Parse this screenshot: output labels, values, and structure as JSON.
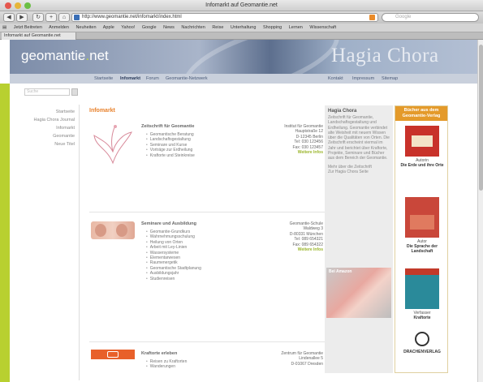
{
  "window": {
    "title": "Infomarkt auf Geomantie.net",
    "url": "http://www.geomantie.net/infomarkt/index.html",
    "search_placeholder": "Google"
  },
  "bookmarks": [
    "Jetzt Beitreten",
    "Anmelden",
    "Neuheiten",
    "Apple",
    "Yahoo!",
    "Google",
    "News",
    "Nachrichten",
    "Reise",
    "Unterhaltung",
    "Shopping",
    "Lernen",
    "Wissenschaft"
  ],
  "tab": {
    "label": "Infomarkt auf Geomantie.net"
  },
  "header": {
    "logo_main": "geomantie",
    "logo_dot": ".",
    "logo_tld": "net",
    "hagia": "Hagia Chora"
  },
  "nav": {
    "items": [
      {
        "label": "Startseite"
      },
      {
        "label": "Infomarkt"
      },
      {
        "label": "Forum"
      },
      {
        "label": "Geomantie-Netzwerk"
      }
    ],
    "right": [
      {
        "label": "Kontakt"
      },
      {
        "label": "Impressum"
      },
      {
        "label": "Sitemap"
      }
    ]
  },
  "left": {
    "search_placeholder": "Suche",
    "links": [
      {
        "label": "Startseite"
      },
      {
        "label": "Hagia Chora Journal"
      },
      {
        "label": "Infomarkt"
      },
      {
        "label": "Geomantie"
      },
      {
        "label": "Neue Titel"
      }
    ]
  },
  "main": {
    "heading": "Infomarkt",
    "entries": [
      {
        "title": "Zeitschrift für Geomantie",
        "bullets": [
          "Geomantische Beratung",
          "Landschaftsgestaltung",
          "Seminare und Kurse",
          "Vorträge zur Erdheilung",
          "Kraftorte und Steinkreise"
        ],
        "address": [
          "Institut für Geomantie",
          "Hauptstraße 12",
          "D-12345 Berlin",
          "Tel: 030 123456",
          "Fax: 030 123457"
        ],
        "more": "Weitere Infos"
      },
      {
        "title": "Seminare und Ausbildung",
        "bullets": [
          "Geomantie-Grundkurs",
          "Wahrnehmungsschulung",
          "Heilung von Orten",
          "Arbeit mit Ley-Linien",
          "Wassersysteme",
          "Elementarwesen",
          "Raumenergetik",
          "Geomantische Stadtplanung",
          "Ausbildungsjahr",
          "Studienreisen"
        ],
        "address": [
          "Geomantie-Schule",
          "Waldweg 3",
          "D-80331 München",
          "Tel: 089 654321",
          "Fax: 089 654322"
        ],
        "more": "Weitere Infos"
      },
      {
        "title": "Kraftorte erleben",
        "bullets": [
          "Reisen zu Kraftorten",
          "Wanderungen"
        ],
        "address": [
          "Zentrum für Geomantie",
          "Lindenallee 5",
          "D-01067 Dresden"
        ],
        "more": ""
      }
    ]
  },
  "sidebar": {
    "head": "Hagia Chora",
    "text": "Zeitschrift für Geomantie, Landschaftsgestaltung und Erdheilung. Geomantie verbindet alte Weisheit mit neuem Wissen über die Qualitäten von Orten. Die Zeitschrift erscheint viermal im Jahr und berichtet über Kraftorte, Projekte, Seminare und Bücher aus dem Bereich der Geomantie.",
    "link1": "Mehr über die Zeitschrift",
    "link2": "Zur Hagia Chora Seite",
    "promo_title": "Bei Amazon"
  },
  "books": {
    "head": "Bücher aus dem Geomantie-Verlag",
    "items": [
      {
        "author": "Autorin",
        "title": "Die Erde und ihre Orte"
      },
      {
        "author": "Autor",
        "title": "Die Sprache der Landschaft"
      },
      {
        "author": "Verfasser",
        "title": "Kraftorte"
      }
    ],
    "publisher": "DRACHENVERLAG"
  },
  "colors": {
    "accent": "#e8802a",
    "green": "#b8d030",
    "header": "#7c8ca8",
    "more": "#9ab52a"
  }
}
